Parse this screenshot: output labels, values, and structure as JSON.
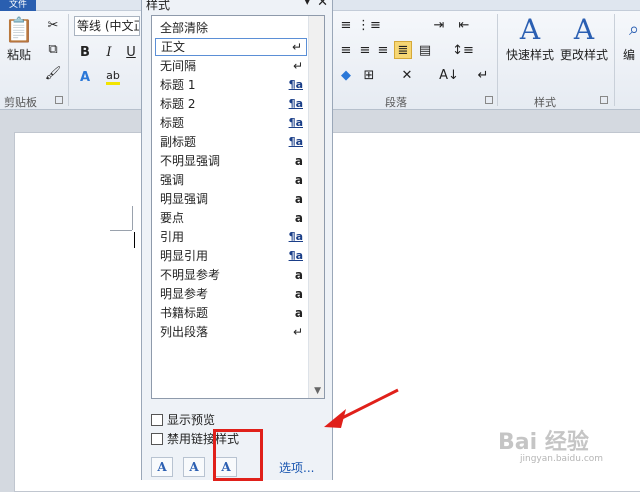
{
  "ribbon": {
    "file_tab": "文件",
    "font_name": "等线 (中文正",
    "groups": {
      "clipboard": "剪贴板",
      "paragraph": "段落",
      "styles": "样式"
    },
    "paste_label": "粘贴",
    "quick_styles_label": "快速样式",
    "change_styles_label": "更改样式",
    "edit_label": "编"
  },
  "pane": {
    "title": "样式",
    "close": "✕",
    "pin": "▾",
    "items": [
      {
        "label": "全部清除",
        "marker": "",
        "kind": "none"
      },
      {
        "label": "正文",
        "marker": "↵",
        "kind": "para"
      },
      {
        "label": "无间隔",
        "marker": "↵",
        "kind": "para"
      },
      {
        "label": "标题 1",
        "marker": "¶a",
        "kind": "linked"
      },
      {
        "label": "标题 2",
        "marker": "¶a",
        "kind": "linked"
      },
      {
        "label": "标题",
        "marker": "¶a",
        "kind": "linked"
      },
      {
        "label": "副标题",
        "marker": "¶a",
        "kind": "linked"
      },
      {
        "label": "不明显强调",
        "marker": "a",
        "kind": "char"
      },
      {
        "label": "强调",
        "marker": "a",
        "kind": "char"
      },
      {
        "label": "明显强调",
        "marker": "a",
        "kind": "char"
      },
      {
        "label": "要点",
        "marker": "a",
        "kind": "char"
      },
      {
        "label": "引用",
        "marker": "¶a",
        "kind": "linked"
      },
      {
        "label": "明显引用",
        "marker": "¶a",
        "kind": "linked"
      },
      {
        "label": "不明显参考",
        "marker": "a",
        "kind": "char"
      },
      {
        "label": "明显参考",
        "marker": "a",
        "kind": "char"
      },
      {
        "label": "书籍标题",
        "marker": "a",
        "kind": "char"
      },
      {
        "label": "列出段落",
        "marker": "↵",
        "kind": "para"
      }
    ],
    "selected_index": 1,
    "show_preview_label": "显示预览",
    "show_preview_checked": false,
    "disable_linked_label": "禁用链接样式",
    "disable_linked_checked": false,
    "options_label": "选项...",
    "buttons": {
      "new_style": "A",
      "style_inspector": "A",
      "manage_styles": "A"
    }
  },
  "watermark": {
    "brand": "Bai 经验",
    "url": "jingyan.baidu.com"
  },
  "colors": {
    "accent_blue": "#2b5fb2",
    "highlight_red": "#e0201a",
    "selected_border": "#5b8fd6"
  }
}
